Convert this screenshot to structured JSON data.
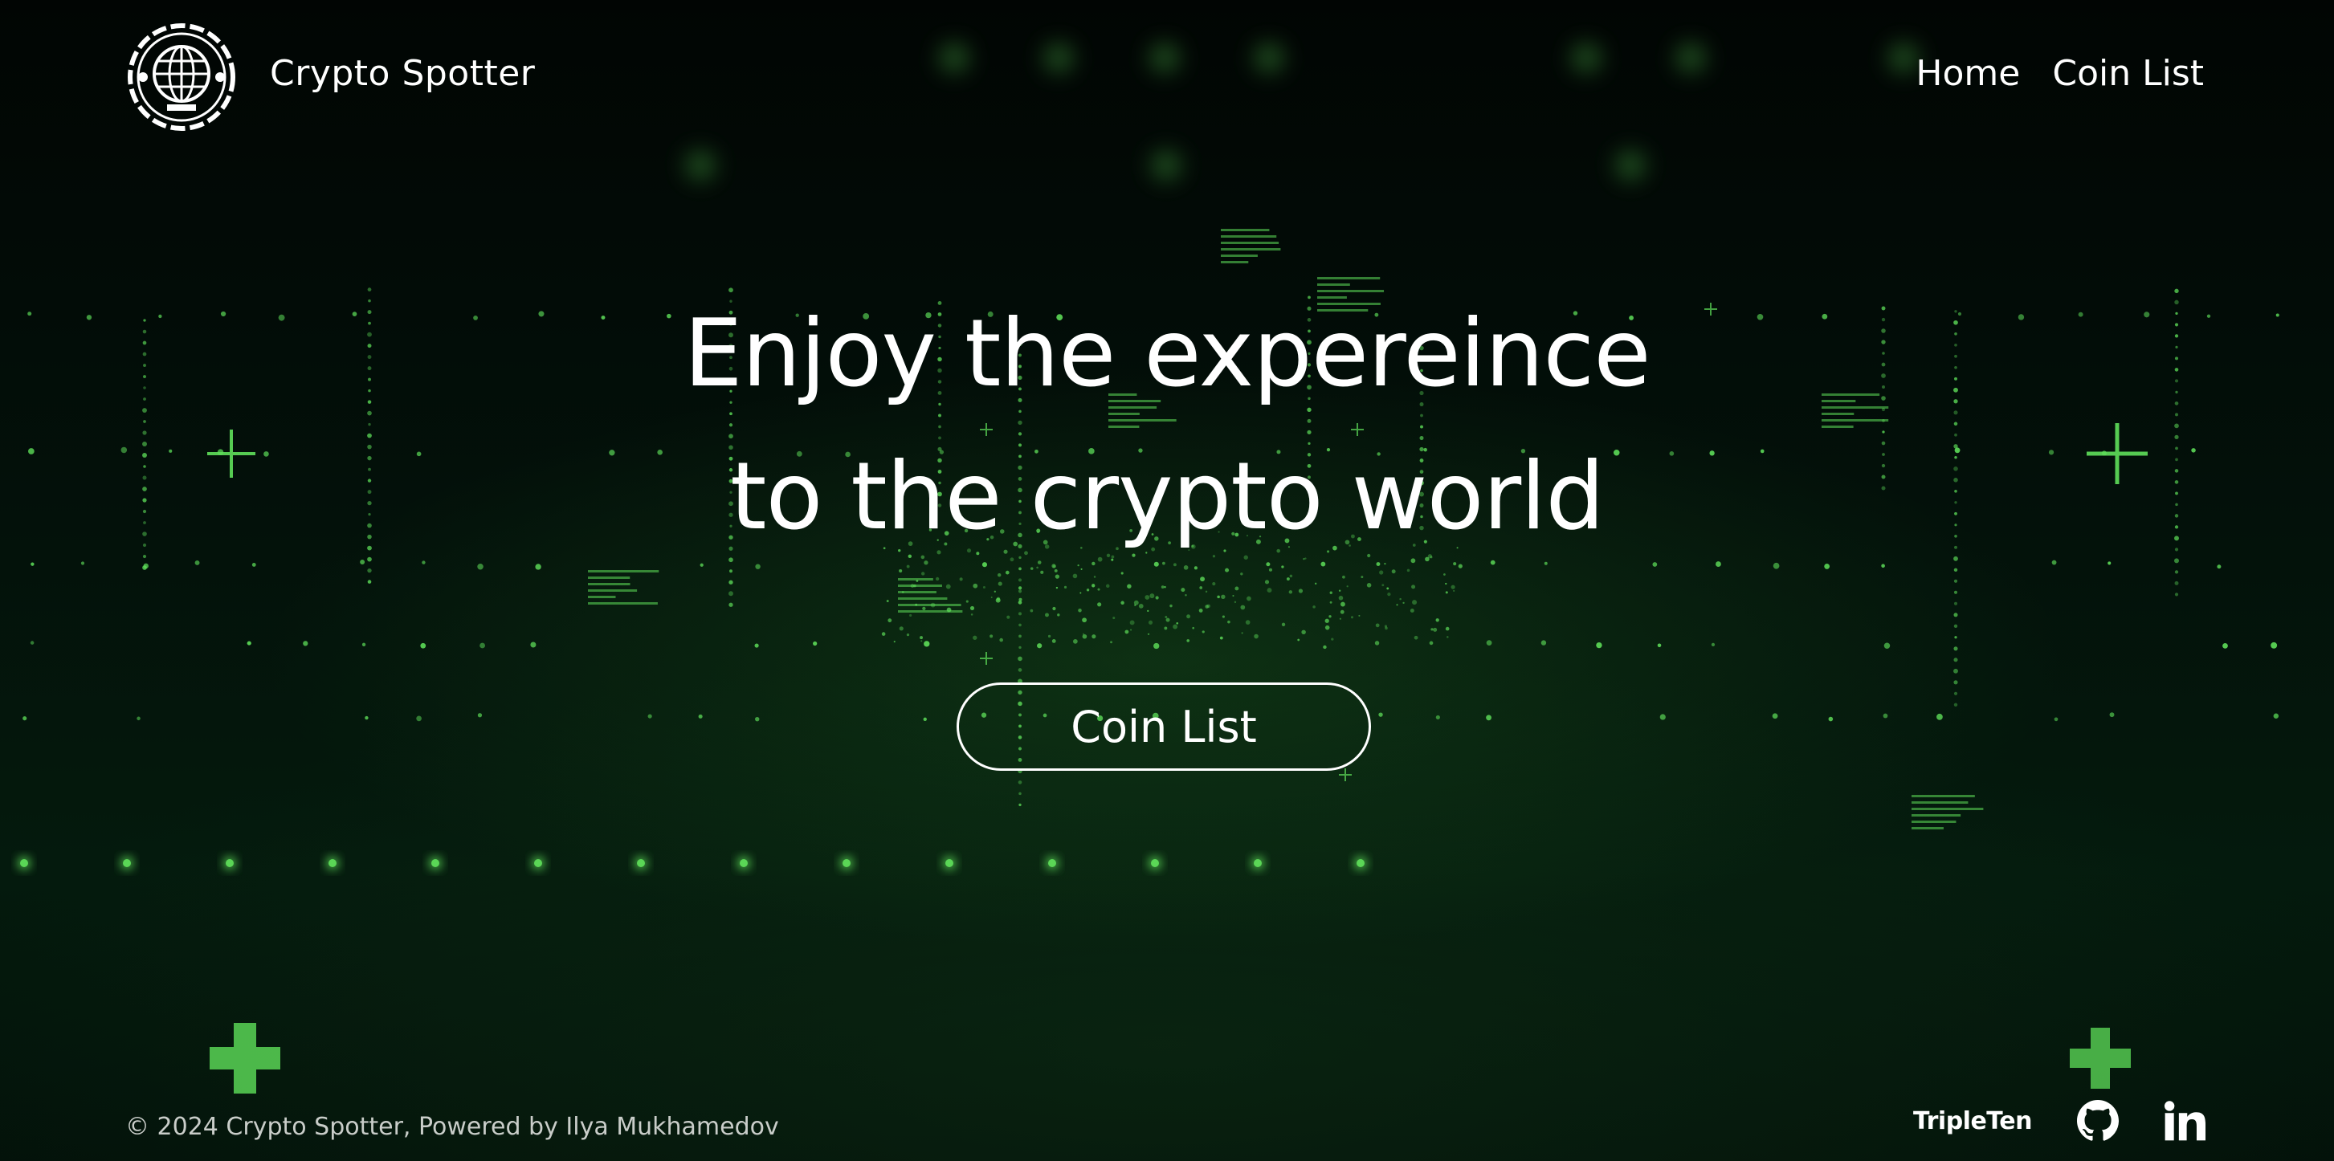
{
  "header": {
    "brand_name": "Crypto Spotter",
    "logo_icon": "globe-gear-icon",
    "nav": [
      {
        "label": "Home"
      },
      {
        "label": "Coin List"
      }
    ]
  },
  "hero": {
    "title_line_1": "Enjoy the expereince",
    "title_line_2": "to the crypto world",
    "button_label": "Coin List"
  },
  "footer": {
    "copyright": "© 2024 Crypto Spotter, Powered by Ilya Mukhamedov",
    "tripleten_label": "TripleTen",
    "github_icon": "github-icon",
    "linkedin_icon": "linkedin-icon"
  },
  "colors": {
    "background": "#020a05",
    "accent_green": "#5fe05a",
    "text": "#ffffff",
    "muted_text": "#c9cdc9"
  }
}
